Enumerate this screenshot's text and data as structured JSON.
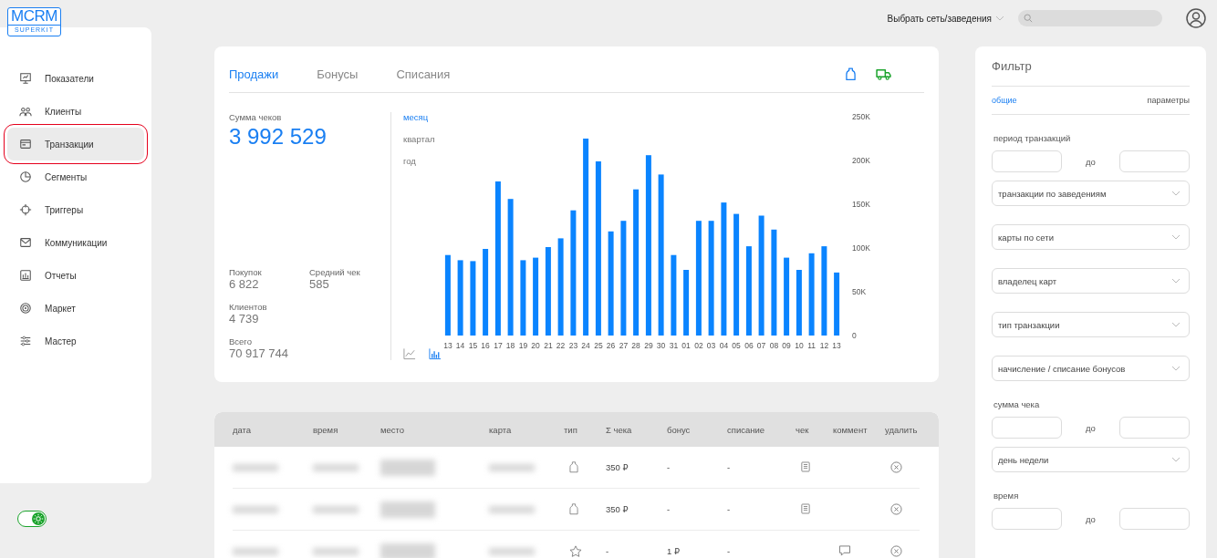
{
  "logo": {
    "title": "MCRM",
    "subtitle": "SUPERKIT"
  },
  "sidebar": {
    "items": [
      {
        "label": "Показатели",
        "selected": false
      },
      {
        "label": "Клиенты",
        "selected": false
      },
      {
        "label": "Транзакции",
        "selected": true
      },
      {
        "label": "Сегменты",
        "selected": false
      },
      {
        "label": "Триггеры",
        "selected": false
      },
      {
        "label": "Коммуникации",
        "selected": false
      },
      {
        "label": "Отчеты",
        "selected": false
      },
      {
        "label": "Маркет",
        "selected": false
      },
      {
        "label": "Мастер",
        "selected": false
      }
    ]
  },
  "theme_toggle": {
    "on": true
  },
  "top_bar": {
    "network_select": "Выбрать сеть/заведения"
  },
  "sales_card": {
    "tabs": [
      {
        "label": "Продажи",
        "selected": true
      },
      {
        "label": "Бонусы",
        "selected": false
      },
      {
        "label": "Списания",
        "selected": false
      }
    ],
    "total": {
      "label": "Сумма чеков",
      "value": "3 992 529"
    },
    "stats": [
      {
        "label": "Покупок",
        "value": "6 822"
      },
      {
        "label": "Средний чек",
        "value": "585"
      },
      {
        "label": "Клиентов",
        "value": "4 739"
      },
      {
        "label": "Всего",
        "value": "70 917 744"
      }
    ],
    "periods": [
      {
        "label": "месяц",
        "selected": true
      },
      {
        "label": "квартал",
        "selected": false
      },
      {
        "label": "год",
        "selected": false
      }
    ],
    "chart_types": [
      {
        "kind": "line",
        "selected": false
      },
      {
        "kind": "bar",
        "selected": true
      }
    ],
    "chart_data": {
      "type": "bar",
      "categories": [
        "13",
        "14",
        "15",
        "16",
        "17",
        "18",
        "19",
        "20",
        "21",
        "22",
        "23",
        "24",
        "25",
        "26",
        "27",
        "28",
        "29",
        "30",
        "31",
        "01",
        "02",
        "03",
        "04",
        "05",
        "06",
        "07",
        "08",
        "09",
        "10",
        "11",
        "12",
        "13"
      ],
      "series": [
        {
          "color": "#0a84ff",
          "values": [
            92000,
            86000,
            85000,
            99000,
            176000,
            156000,
            86000,
            89000,
            101000,
            111000,
            143000,
            225000,
            199000,
            119000,
            131000,
            167000,
            206000,
            184000,
            92000,
            75000,
            131000,
            131000,
            152000,
            139000,
            102000,
            137000,
            121000,
            89000,
            75000,
            94000,
            102000,
            72000
          ]
        }
      ],
      "ylim": [
        0,
        250000
      ],
      "yticks": [
        {
          "value": 0,
          "label": "0"
        },
        {
          "value": 50000,
          "label": "50K"
        },
        {
          "value": 100000,
          "label": "100K"
        },
        {
          "value": 150000,
          "label": "150K"
        },
        {
          "value": 200000,
          "label": "200K"
        },
        {
          "value": 250000,
          "label": "250K"
        }
      ]
    }
  },
  "table": {
    "columns": [
      "дата",
      "время",
      "место",
      "карта",
      "тип",
      "Σ чека",
      "бонус",
      "списание",
      "чек",
      "коммент",
      "удалить"
    ],
    "rows": [
      {
        "kind": "purchase",
        "sum": "350 ₽",
        "bonus": "-",
        "writeoff": "-",
        "receipt": true,
        "comment": false
      },
      {
        "kind": "purchase",
        "sum": "350 ₽",
        "bonus": "-",
        "writeoff": "-",
        "receipt": true,
        "comment": false
      },
      {
        "kind": "bonus",
        "sum": "-",
        "bonus": "1 ₽",
        "writeoff": "-",
        "receipt": false,
        "comment": true
      }
    ]
  },
  "filter": {
    "title": "Фильтр",
    "tabs": [
      {
        "label": "общие",
        "selected": true
      },
      {
        "label": "параметры",
        "selected": false
      }
    ],
    "items": [
      {
        "kind": "range",
        "label": "период транзакций",
        "between": "до"
      },
      {
        "kind": "select",
        "text": "транзакции по заведениям"
      },
      {
        "kind": "select",
        "text": "карты по сети"
      },
      {
        "kind": "select",
        "text": "владелец карт"
      },
      {
        "kind": "select",
        "text": "тип транзакции"
      },
      {
        "kind": "select",
        "text": "начисление / списание бонусов"
      },
      {
        "kind": "range",
        "label": "сумма чека",
        "between": "до"
      },
      {
        "kind": "select",
        "text": "день недели"
      },
      {
        "kind": "range",
        "label": "время",
        "between": "до"
      }
    ]
  }
}
